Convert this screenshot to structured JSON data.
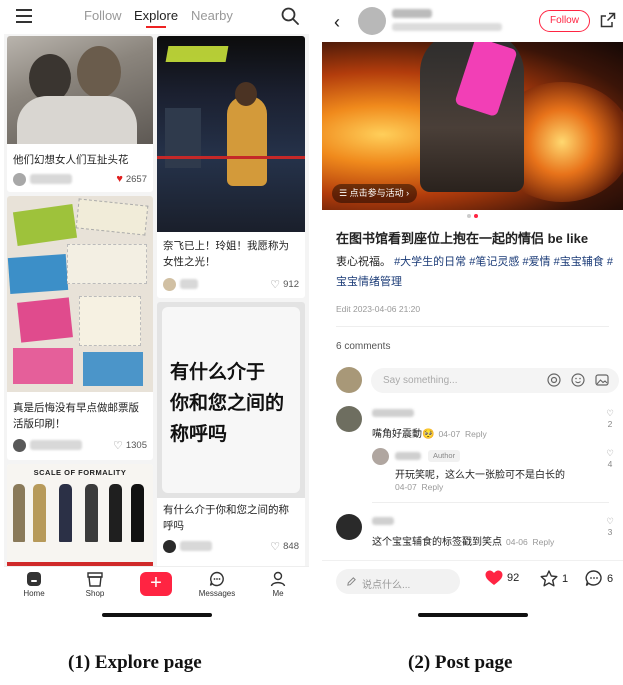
{
  "explore": {
    "tabs": [
      "Follow",
      "Explore",
      "Nearby"
    ],
    "cards": [
      {
        "title": "他们幻想女人们互扯头花",
        "likes": "2657",
        "liked": true
      },
      {
        "title": "奈飞已上！玲姐！我愿称为女性之光！",
        "likes": "912",
        "liked": false
      },
      {
        "title": "真是后悔没有早点做邮票版活版印刷！",
        "likes": "1305",
        "liked": false
      },
      {
        "title": "有什么介于你和您之间的称呼吗",
        "likes": "848",
        "liked": false
      }
    ],
    "poster_text": [
      "有什么介于",
      "你和您之间的",
      "称呼吗"
    ],
    "formality_banner": "SCALE OF FORMALITY",
    "nav": [
      "Home",
      "Shop",
      "",
      "Messages",
      "Me"
    ],
    "plus": "+"
  },
  "post": {
    "follow_label": "Follow",
    "activity_label": "点击参与活动 ›",
    "title": "在图书馆看到座位上抱在一起的情侣 be like",
    "body_text": "衷心祝福。",
    "tags": [
      "#大学生的日常",
      "#笔记灵感",
      "#爱情",
      "#宝宝辅食",
      "#宝宝情绪管理"
    ],
    "edit_date": "Edit 2023-04-06 21:20",
    "comments_count": "6 comments",
    "say_placeholder": "Say something...",
    "comments": [
      {
        "text": "嘴角好震動🥺",
        "date": "04-07",
        "reply": "Reply",
        "likes": "2"
      },
      {
        "badge": "Author",
        "text": "开玩笑呢，这么大一张脸可不是白长的",
        "date": "04-07",
        "reply": "Reply",
        "likes": "4"
      },
      {
        "text": "这个宝宝辅食的标签戳到笑点",
        "date": "04-06",
        "reply": "Reply",
        "likes": "3"
      }
    ],
    "bottom": {
      "say": "说点什么...",
      "likes": "92",
      "stars": "1",
      "comments": "6"
    }
  },
  "captions": [
    "(1) Explore page",
    "(2) Post page"
  ],
  "colors": {
    "accent": "#ff2442",
    "tag": "#1c3c78"
  }
}
